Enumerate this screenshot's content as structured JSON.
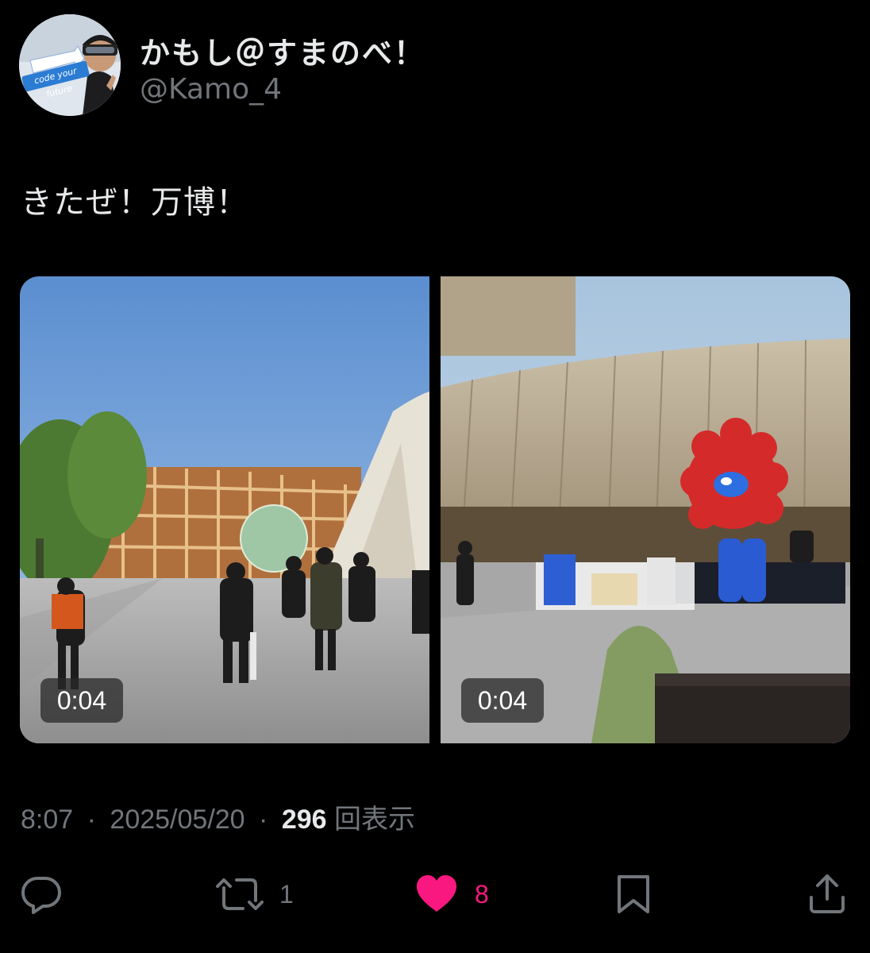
{
  "user": {
    "display_name": "かもし＠すまのべ！",
    "handle": "@Kamo_4",
    "avatar_text": "code your future"
  },
  "tweet": {
    "text": "きたぜ！万博！"
  },
  "media": [
    {
      "duration": "0:04"
    },
    {
      "duration": "0:04"
    }
  ],
  "meta": {
    "time": "8:07",
    "separator": "·",
    "date": "2025/05/20",
    "views_count": "296",
    "views_label": "回表示"
  },
  "actions": {
    "reply": {
      "icon": "reply-icon"
    },
    "retweet": {
      "icon": "retweet-icon",
      "count": "1"
    },
    "like": {
      "icon": "heart-icon",
      "count": "8",
      "active": true
    },
    "bookmark": {
      "icon": "bookmark-icon"
    },
    "share": {
      "icon": "share-icon"
    }
  },
  "colors": {
    "background": "#000000",
    "text_primary": "#e7e9ea",
    "text_secondary": "#71767b",
    "like_pink": "#f91880"
  }
}
